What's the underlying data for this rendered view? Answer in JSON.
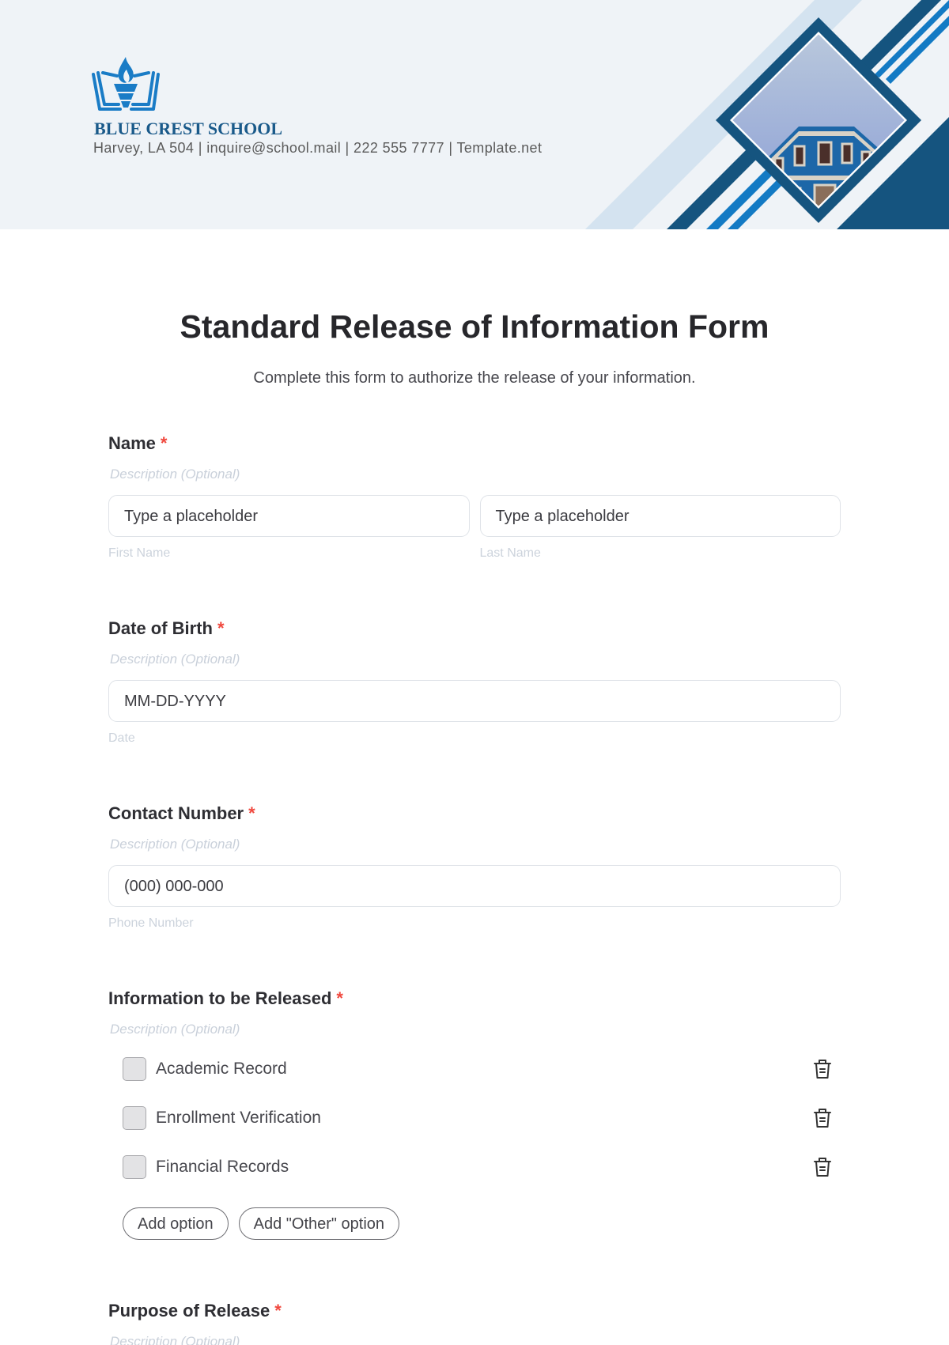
{
  "header": {
    "school_name": "BLUE CREST SCHOOL",
    "contact_line": "Harvey, LA 504 | inquire@school.mail | 222 555 7777 | Template.net",
    "logo_icon": "torch-book-logo",
    "image": "blue-building-photo",
    "colors": {
      "band": "#eff3f7",
      "navy": "#15547f",
      "blue": "#137ac4",
      "light": "#d4e3f0"
    }
  },
  "form": {
    "title": "Standard Release of Information Form",
    "subtitle": "Complete this form to authorize the release of your information.",
    "required_mark": "*",
    "fields": {
      "name": {
        "label": "Name",
        "description": "Description (Optional)",
        "first_placeholder": "Type a placeholder",
        "last_placeholder": "Type a placeholder",
        "first_sublabel": "First Name",
        "last_sublabel": "Last Name"
      },
      "dob": {
        "label": "Date of Birth",
        "description": "Description (Optional)",
        "placeholder": "MM-DD-YYYY",
        "sublabel": "Date"
      },
      "contact": {
        "label": "Contact Number",
        "description": "Description (Optional)",
        "placeholder": "(000) 000-000",
        "sublabel": "Phone Number"
      },
      "info": {
        "label": "Information to be Released",
        "description": "Description (Optional)",
        "options": [
          {
            "label": "Academic Record",
            "checked": false
          },
          {
            "label": "Enrollment Verification",
            "checked": false
          },
          {
            "label": "Financial Records",
            "checked": false
          }
        ],
        "add_option": "Add option",
        "add_other_option": "Add \"Other\" option"
      },
      "purpose": {
        "label": "Purpose of Release",
        "description": "Description (Optional)"
      }
    },
    "colors": {
      "required": "#f0483e",
      "muted": "#c9d0da"
    }
  }
}
